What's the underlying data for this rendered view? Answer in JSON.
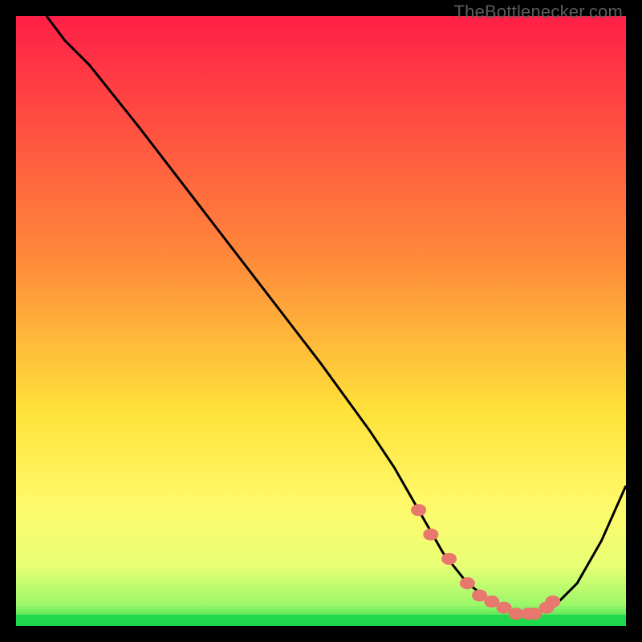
{
  "watermark": {
    "text": "TheBottlenecker.com"
  },
  "colors": {
    "frame": "#000000",
    "curve": "#000000",
    "marker_fill": "#e8776d",
    "marker_stroke": "#e8776d",
    "green_band": "#1fd84b"
  },
  "chart_data": {
    "type": "line",
    "title": "",
    "xlabel": "",
    "ylabel": "",
    "xlim": [
      0,
      100
    ],
    "ylim": [
      0,
      100
    ],
    "gradient_stops": [
      {
        "offset": 0.0,
        "color": "#ff1f47"
      },
      {
        "offset": 0.4,
        "color": "#ff8a3a"
      },
      {
        "offset": 0.65,
        "color": "#ffe23a"
      },
      {
        "offset": 0.8,
        "color": "#fff96a"
      },
      {
        "offset": 0.9,
        "color": "#e9ff75"
      },
      {
        "offset": 0.965,
        "color": "#9cf76a"
      },
      {
        "offset": 1.0,
        "color": "#1fd84b"
      }
    ],
    "series": [
      {
        "name": "bottleneck-curve",
        "x": [
          5,
          8,
          12,
          20,
          30,
          40,
          50,
          58,
          62,
          66,
          70,
          74,
          78,
          82,
          85,
          88,
          92,
          96,
          100
        ],
        "y": [
          100,
          96,
          92,
          82,
          69,
          56,
          43,
          32,
          26,
          19,
          12,
          7,
          4,
          2,
          2,
          3,
          7,
          14,
          23
        ]
      }
    ],
    "markers": {
      "name": "highlighted-points",
      "x": [
        66,
        68,
        71,
        74,
        76,
        78,
        80,
        82,
        84,
        85,
        87,
        88
      ],
      "y": [
        19,
        15,
        11,
        7,
        5,
        4,
        3,
        2,
        2,
        2,
        3,
        4
      ]
    }
  }
}
